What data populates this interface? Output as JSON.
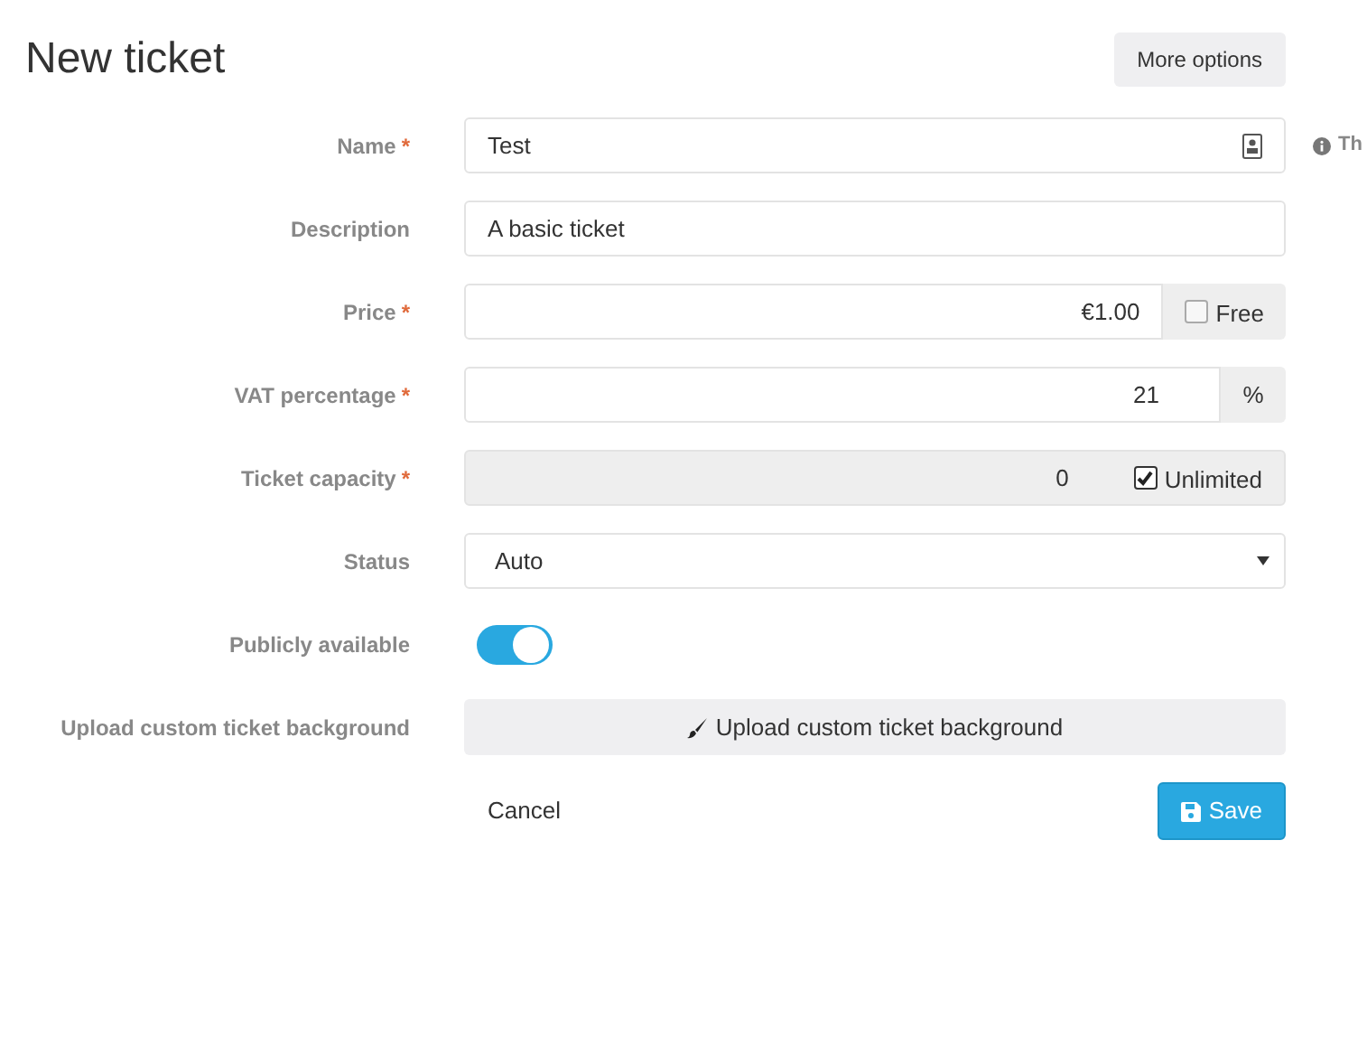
{
  "title": "New ticket",
  "more_options": "More options",
  "fields": [
    {
      "kind": "text",
      "label": "Name",
      "required_mark": "*",
      "value": "Test",
      "icon": true,
      "hint": "Th"
    },
    {
      "kind": "text",
      "label": "Description",
      "value": "A basic ticket"
    },
    {
      "kind": "checkbox_addon",
      "label": "Price",
      "required_mark": "*",
      "value": "€1.00",
      "addon": "Free",
      "checked": false,
      "disabled": false
    },
    {
      "kind": "text_addon",
      "label": "VAT percentage",
      "required_mark": "*",
      "value": "21",
      "addon": "%"
    },
    {
      "kind": "checkbox_addon",
      "label": "Ticket capacity",
      "required_mark": "*",
      "value": "0",
      "addon": "Unlimited",
      "checked": true,
      "disabled": true
    },
    {
      "kind": "select",
      "label": "Status",
      "value": "Auto"
    },
    {
      "kind": "toggle",
      "label": "Publicly available",
      "on": true
    },
    {
      "kind": "upload",
      "label": "Upload custom ticket background",
      "button": "Upload custom ticket background"
    }
  ],
  "cancel": "Cancel",
  "save": "Save"
}
